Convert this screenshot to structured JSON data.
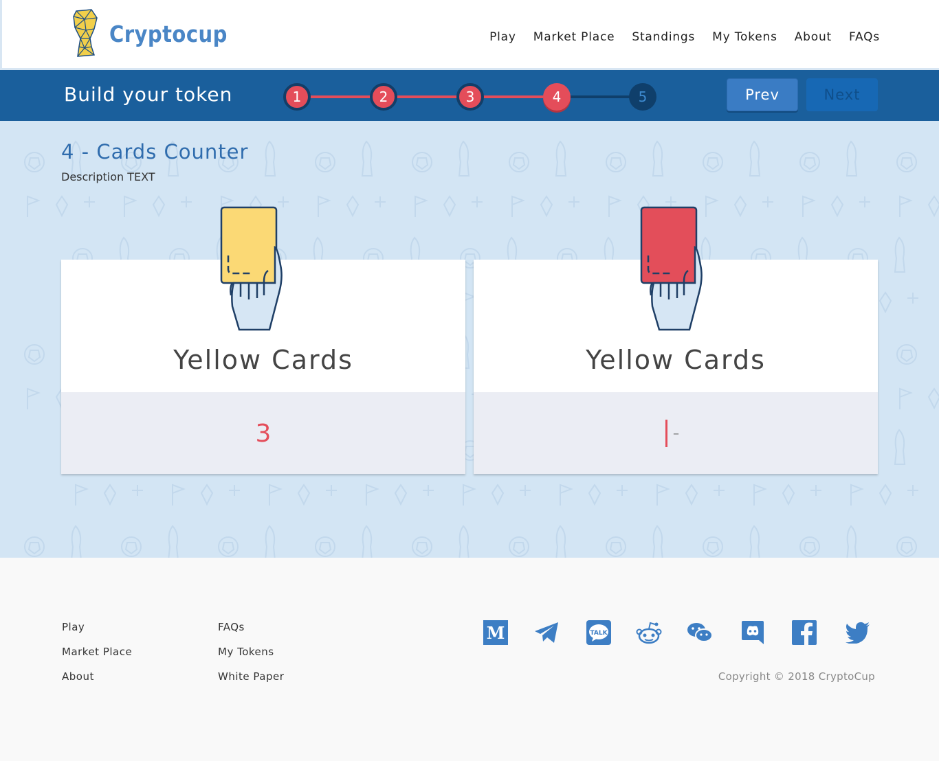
{
  "brand": {
    "name": "Cryptocup",
    "color": "#4a86c6"
  },
  "nav": [
    {
      "label": "Play"
    },
    {
      "label": "Market Place"
    },
    {
      "label": "Standings"
    },
    {
      "label": "My Tokens"
    },
    {
      "label": "About"
    },
    {
      "label": "FAQs"
    }
  ],
  "builder": {
    "title": "Build your token",
    "current_step": 4,
    "steps": [
      {
        "label": "1",
        "state": "done"
      },
      {
        "label": "2",
        "state": "done"
      },
      {
        "label": "3",
        "state": "done"
      },
      {
        "label": "4",
        "state": "current"
      },
      {
        "label": "5",
        "state": "todo"
      }
    ],
    "prev_label": "Prev",
    "next_label": "Next"
  },
  "section": {
    "title": "4 - Cards Counter",
    "description": "Description TEXT"
  },
  "cards": [
    {
      "label": "Yellow Cards",
      "value": "3",
      "card_color": "#fbd975",
      "icon": "yellow-card-hand-icon"
    },
    {
      "label": "Yellow Cards",
      "input_value": "",
      "placeholder": "–",
      "card_color": "#e34e5a",
      "icon": "red-card-hand-icon"
    }
  ],
  "footer": {
    "links_col1": [
      "Play",
      "Market Place",
      "About"
    ],
    "links_col2": [
      "FAQs",
      "My Tokens",
      "White Paper"
    ],
    "social": [
      "medium-icon",
      "telegram-icon",
      "kakaotalk-icon",
      "reddit-icon",
      "wechat-icon",
      "discord-icon",
      "facebook-icon",
      "twitter-icon"
    ],
    "copyright": "Copyright © 2018 CryptoCup"
  },
  "colors": {
    "primary": "#1a5f9c",
    "accent_red": "#e44d5a",
    "background": "#d3e5f4",
    "footer_bg": "#f9f9f9"
  }
}
